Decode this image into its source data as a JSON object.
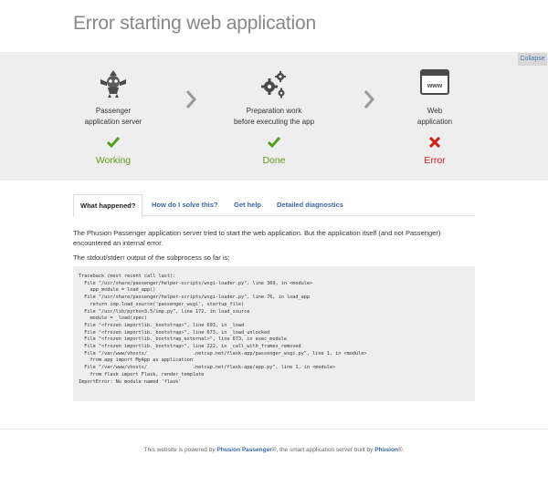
{
  "page": {
    "title": "Error starting web application"
  },
  "collapse_label": "Collapse",
  "steps": [
    {
      "icon": "robot-icon",
      "label_line1": "Passenger",
      "label_line2": "application server",
      "status": "Working",
      "status_kind": "ok"
    },
    {
      "icon": "gears-icon",
      "label_line1": "Preparation work",
      "label_line2": "before executing the app",
      "status": "Done",
      "status_kind": "ok"
    },
    {
      "icon": "browser-window-icon",
      "icon_text": "www",
      "label_line1": "Web",
      "label_line2": "application",
      "status": "Error",
      "status_kind": "error"
    }
  ],
  "tabs": [
    {
      "label": "What happened?",
      "active": true
    },
    {
      "label": "How do I solve this?",
      "active": false
    },
    {
      "label": "Get help",
      "active": false
    },
    {
      "label": "Detailed diagnostics",
      "active": false
    }
  ],
  "content": {
    "intro": "The Phusion Passenger application server tried to start the web application. But the application itself (and not Passenger) encountered an internal error.",
    "output_intro": "The stdout/stderr output of the subprocess so far is:",
    "traceback": "Traceback (most recent call last):\n  File \"/usr/share/passenger/helper-scripts/wsgi-loader.py\", line 369, in <module>\n    app_module = load_app()\n  File \"/usr/share/passenger/helper-scripts/wsgi-loader.py\", line 76, in load_app\n    return imp.load_source('passenger_wsgi', startup_file)\n  File \"/usr/lib/python3.5/imp.py\", line 172, in load_source\n    module = _load(spec)\n  File \"<frozen importlib._bootstrap>\", line 693, in _load\n  File \"<frozen importlib._bootstrap>\", line 673, in _load_unlocked\n  File \"<frozen importlib._bootstrap_external>\", line 673, in exec_module\n  File \"<frozen importlib._bootstrap>\", line 222, in _call_with_frames_removed\n  File \"/var/www/vhosts/                .netcup.net/flask-app/passenger_wsgi.py\", line 1, in <module>\n    from app import MyApp as application\n  File \"/var/www/vhosts/                .netcup.net/flask-app/app.py\", line 1, in <module>\n    from flask import Flask, render_template\nImportError: No module named 'flask'"
  },
  "footer": {
    "prefix": "This website is powered by ",
    "product": "Phusion Passenger",
    "middle": "®, the smart application server built by ",
    "company": "Phusion",
    "suffix": "®."
  },
  "colors": {
    "ok": "#5a9e1f",
    "error": "#d0201a",
    "link": "#3a66a8"
  }
}
